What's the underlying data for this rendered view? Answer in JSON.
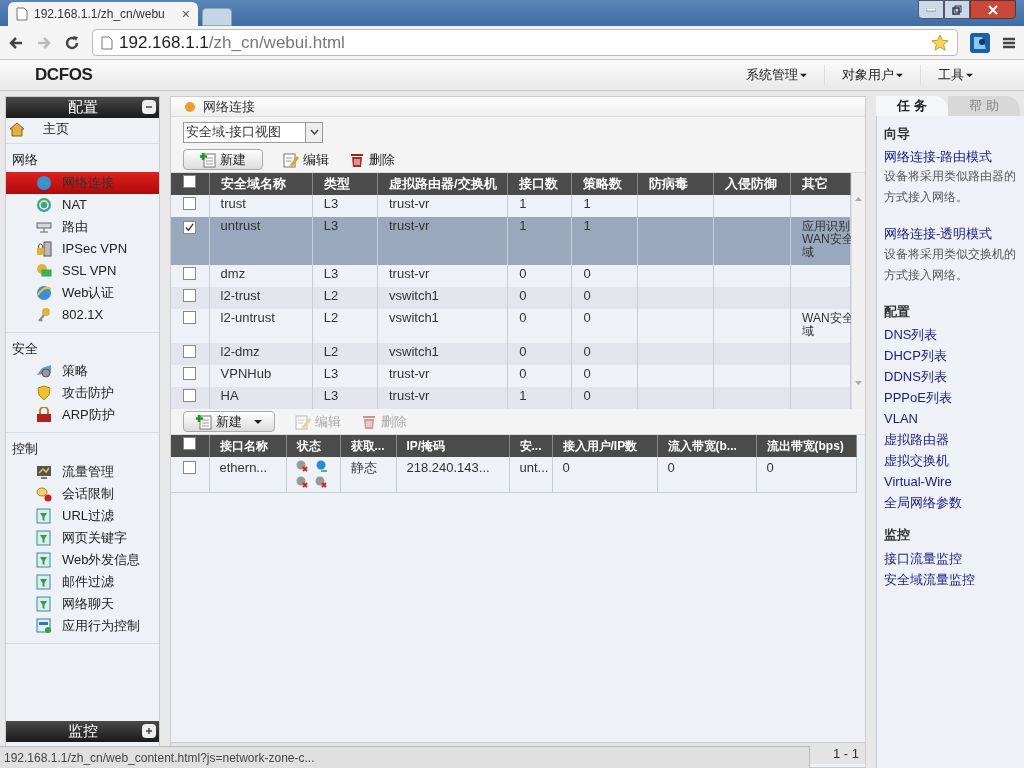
{
  "browser": {
    "tab_title": "192.168.1.1/zh_cn/webu",
    "tab_close": "×",
    "address": {
      "host": "192.168.1.1",
      "path": "/zh_cn/webui.html"
    }
  },
  "app": {
    "logo": "DCFOS",
    "menus": [
      "系统管理",
      "对象用户",
      "工具"
    ]
  },
  "sidebar": {
    "top_header": {
      "title": "配置",
      "expanded": true
    },
    "home": {
      "label": "主页"
    },
    "groups": [
      {
        "title": "网络",
        "items": [
          {
            "label": "网络连接",
            "selected": true
          },
          {
            "label": "NAT",
            "selected": false
          },
          {
            "label": "路由",
            "selected": false
          },
          {
            "label": "IPSec VPN",
            "selected": false
          },
          {
            "label": "SSL VPN",
            "selected": false
          },
          {
            "label": "Web认证",
            "selected": false
          },
          {
            "label": "802.1X",
            "selected": false
          }
        ]
      },
      {
        "title": "安全",
        "items": [
          {
            "label": "策略",
            "selected": false
          },
          {
            "label": "攻击防护",
            "selected": false
          },
          {
            "label": "ARP防护",
            "selected": false
          }
        ]
      },
      {
        "title": "控制",
        "items": [
          {
            "label": "流量管理",
            "selected": false
          },
          {
            "label": "会话限制",
            "selected": false
          },
          {
            "label": "URL过滤",
            "selected": false
          },
          {
            "label": "网页关键字",
            "selected": false
          },
          {
            "label": "Web外发信息",
            "selected": false
          },
          {
            "label": "邮件过滤",
            "selected": false
          },
          {
            "label": "网络聊天",
            "selected": false
          },
          {
            "label": "应用行为控制",
            "selected": false
          }
        ]
      }
    ],
    "bottom_header": {
      "title": "监控",
      "expanded": false
    }
  },
  "main": {
    "breadcrumb": "网络连接",
    "view_select": "安全域-接口视图",
    "toolbar": [
      {
        "label": "新建",
        "kind": "new",
        "disabled": false,
        "dropdown": false
      },
      {
        "label": "编辑",
        "kind": "edit",
        "disabled": false,
        "dropdown": false
      },
      {
        "label": "删除",
        "kind": "delete",
        "disabled": false,
        "dropdown": false
      }
    ],
    "zones": {
      "columns": [
        "安全域名称",
        "类型",
        "虚拟路由器/交换机",
        "接口数",
        "策略数",
        "防病毒",
        "入侵防御",
        "其它"
      ],
      "all_checked": false,
      "rows": [
        {
          "cells": [
            "trust",
            "L3",
            "trust-vr",
            "1",
            "1",
            "",
            ""
          ],
          "other": [],
          "checked": false,
          "selected": false
        },
        {
          "cells": [
            "untrust",
            "L3",
            "trust-vr",
            "1",
            "1",
            "",
            ""
          ],
          "other": [
            "应用识别",
            "WAN安全",
            "域"
          ],
          "checked": true,
          "selected": true
        },
        {
          "cells": [
            "dmz",
            "L3",
            "trust-vr",
            "0",
            "0",
            "",
            ""
          ],
          "other": [],
          "checked": false,
          "selected": false
        },
        {
          "cells": [
            "l2-trust",
            "L2",
            "vswitch1",
            "0",
            "0",
            "",
            ""
          ],
          "other": [],
          "checked": false,
          "selected": false
        },
        {
          "cells": [
            "l2-untrust",
            "L2",
            "vswitch1",
            "0",
            "0",
            "",
            ""
          ],
          "other": [
            "WAN安全",
            "域"
          ],
          "checked": false,
          "selected": false
        },
        {
          "cells": [
            "l2-dmz",
            "L2",
            "vswitch1",
            "0",
            "0",
            "",
            ""
          ],
          "other": [],
          "checked": false,
          "selected": false
        },
        {
          "cells": [
            "VPNHub",
            "L3",
            "trust-vr",
            "0",
            "0",
            "",
            ""
          ],
          "other": [],
          "checked": false,
          "selected": false
        },
        {
          "cells": [
            "HA",
            "L3",
            "trust-vr",
            "1",
            "0",
            "",
            ""
          ],
          "other": [],
          "checked": false,
          "selected": false
        }
      ]
    },
    "toolbar2": [
      {
        "label": "新建",
        "kind": "new",
        "disabled": false,
        "dropdown": true
      },
      {
        "label": "编辑",
        "kind": "edit",
        "disabled": true,
        "dropdown": false
      },
      {
        "label": "删除",
        "kind": "delete",
        "disabled": true,
        "dropdown": false
      }
    ],
    "interfaces": {
      "columns": [
        "接口名称",
        "状态",
        "获取...",
        "IP/掩码",
        "安...",
        "接入用户/IP数",
        "流入带宽(b...",
        "流出带宽(bps)"
      ],
      "all_checked": false,
      "rows": [
        {
          "cells": [
            "ethern...",
            "",
            "静态",
            "218.240.143...",
            "unt...",
            "0",
            "0",
            "0"
          ],
          "status": [
            {
              "on": false
            },
            {
              "on": true
            },
            {
              "on": false
            },
            {
              "on": false
            }
          ],
          "checked": false
        }
      ]
    },
    "pager": "1 - 1"
  },
  "right_panel": {
    "tabs": [
      {
        "label": "任 务",
        "selected": true
      },
      {
        "label": "帮 助",
        "selected": false
      }
    ],
    "sections": [
      {
        "title": "向导",
        "entries": [
          {
            "link": "网络连接-路由模式",
            "text": "设备将采用类似路由器的方式接入网络。"
          },
          {
            "link": "网络连接-透明模式",
            "text": "设备将采用类似交换机的方式接入网络。"
          }
        ]
      },
      {
        "title": "配置",
        "links": [
          "DNS列表",
          "DHCP列表",
          "DDNS列表",
          "PPPoE列表",
          "VLAN",
          "虚拟路由器",
          "虚拟交换机",
          "Virtual-Wire",
          "全局网络参数"
        ]
      },
      {
        "title": "监控",
        "links": [
          "接口流量监控",
          "安全域流量监控"
        ]
      }
    ]
  },
  "status_bar": "192.168.1.1/zh_cn/web_content.html?js=network-zone-c..."
}
